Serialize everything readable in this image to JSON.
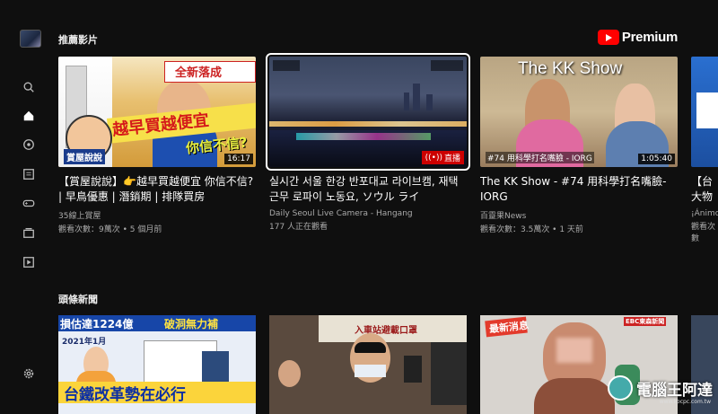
{
  "sidebar": {
    "icons": [
      "search-icon",
      "home-icon",
      "explore-icon",
      "subscriptions-icon",
      "gaming-icon",
      "library-icon",
      "playlist-icon",
      "settings-icon"
    ]
  },
  "brand": {
    "premium_label": "Premium"
  },
  "sections": {
    "recommended": "推薦影片",
    "headlines": "頭條新聞"
  },
  "recommended_videos": [
    {
      "title": "【賞屋說說】👉越早買越便宜 你信不信? | 早鳥優惠 | 潛銷期 | 排隊買房",
      "channel": "35線上賞屋",
      "meta": "觀看次數：9萬次 • 5 個月前",
      "duration": "16:17",
      "thumb_text_1": "越早買越便宜",
      "thumb_text_2": "你信不信?",
      "thumb_text_3": "賞屋說說",
      "thumb_text_4": "全新落成"
    },
    {
      "title": "실시간 서울 한강 반포대교 라이브캠, 재택근무 로파이 노동요, ソウル ライ",
      "channel": "Daily Seoul Live Camera - Hangang",
      "meta": "177 人正在觀看",
      "live_label": "直播"
    },
    {
      "title": "The KK Show - #74 用科學打名嘴臉-IORG",
      "channel": "百靈果News",
      "meta": "觀看次數：3.5萬次 • 1 天前",
      "duration": "1:05:40",
      "thumb_text_1": "The KK Show",
      "thumb_text_2": "#74 用科學打名嘴臉 - IORG"
    },
    {
      "title": "【台大物",
      "channel": "¡Ánimo",
      "meta": "觀看次數"
    }
  ],
  "news": [
    {
      "banner_1": "損估達1224億",
      "banner_2": "破洞無力補",
      "year": "2021年1月",
      "bottom": "台鐵改革勢在必行"
    },
    {
      "banner": "入車站避載口罩"
    },
    {
      "badge": "最新消息",
      "channel": "EBC東森新聞"
    }
  ],
  "watermark": {
    "text": "電腦王阿達",
    "url": "www.kocpc.com.tw"
  }
}
